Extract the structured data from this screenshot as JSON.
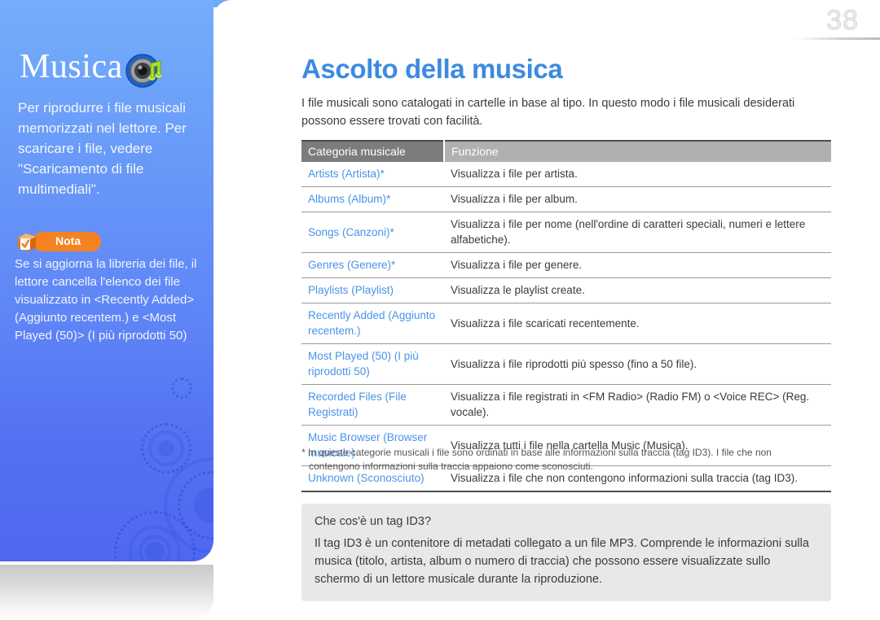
{
  "page": {
    "number": "38",
    "accent_blue": "#4a93e8",
    "heading_blue": "#3d8ae0",
    "sidebar_blue_top": "#74aefb",
    "sidebar_blue_bottom": "#4e68f0",
    "nota_orange": "#f58220",
    "header_col1_gray": "#7c7c7c",
    "header_col2_gray": "#b0b0b0",
    "infobox_gray": "#e8e8e8"
  },
  "sidebar": {
    "title": "Musica",
    "icon": "music-speaker-icon",
    "intro": "Per riprodurre i file musicali memorizzati nel lettore. Per scaricare i file, vedere \"Scaricamento di file multimediali\".",
    "note": {
      "icon": "note-cube-check-icon",
      "label": "Nota",
      "text": "Se si aggiorna la libreria dei file, il lettore cancella l'elenco dei file visualizzato in <Recently Added> (Aggiunto recentem.) e <Most Played (50)> (I più riprodotti 50)"
    }
  },
  "main": {
    "heading": "Ascolto della musica",
    "lead": "I file musicali sono catalogati in cartelle in base al tipo. In questo modo i file musicali desiderati possono essere trovati con facilità.",
    "table": {
      "headers": [
        "Categoria musicale",
        "Funzione"
      ],
      "rows": [
        {
          "category": "Artists (Artista)*",
          "function": "Visualizza i file per artista."
        },
        {
          "category": "Albums (Album)*",
          "function": "Visualizza i file per album."
        },
        {
          "category": "Songs (Canzoni)*",
          "function": "Visualizza i file per nome (nell'ordine di caratteri speciali, numeri e lettere alfabetiche)."
        },
        {
          "category": "Genres (Genere)*",
          "function": "Visualizza i file per genere."
        },
        {
          "category": "Playlists (Playlist)",
          "function": "Visualizza le playlist create."
        },
        {
          "category": "Recently Added (Aggiunto recentem.)",
          "function": "Visualizza i file scaricati recentemente."
        },
        {
          "category": "Most Played (50) (I più riprodotti 50)",
          "function": "Visualizza i file riprodotti più spesso (fino a 50 file)."
        },
        {
          "category": "Recorded Files (File Registrati)",
          "function": "Visualizza i file registrati in <FM Radio> (Radio FM) o <Voice REC> (Reg. vocale)."
        },
        {
          "category": "Music Browser (Browser musicale)",
          "function": "Visualizza tutti i file nella cartella Music (Musica)."
        },
        {
          "category": "Unknown (Sconosciuto)",
          "function": "Visualizza i file che non contengono informazioni sulla traccia (tag ID3)."
        }
      ]
    },
    "footnote_line1": "* In queste categorie musicali i file sono ordinati in base alle informazioni sulla traccia (tag ID3). I file che non",
    "footnote_line2": "contengono informazioni sulla traccia appaiono come sconosciuti.",
    "infobox": {
      "title": "Che cos'è un tag ID3?",
      "body": "Il tag ID3 è un contenitore di metadati collegato a un file MP3. Comprende le informazioni sulla musica (titolo, artista, album o numero di traccia) che possono essere visualizzate sullo schermo di un lettore musicale durante la riproduzione."
    }
  }
}
